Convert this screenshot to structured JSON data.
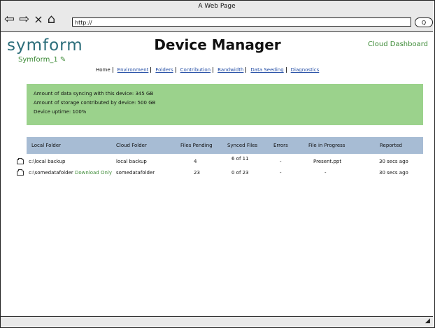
{
  "browser": {
    "title": "A Web Page",
    "url": "http://",
    "search_icon_text": "Q"
  },
  "header": {
    "logo": "symform",
    "title": "Device Manager",
    "cloud_link": "Cloud Dashboard",
    "machine_name": "Symform_1"
  },
  "tabs": [
    {
      "label": "Home"
    },
    {
      "label": "Environment"
    },
    {
      "label": "Folders"
    },
    {
      "label": "Contribution"
    },
    {
      "label": "Bandwidth"
    },
    {
      "label": "Data Seeding"
    },
    {
      "label": "Diagnostics"
    }
  ],
  "summary": {
    "line1": "Amount of data syncing with this device: 345 GB",
    "line2": "Amount of storage contributed by device: 500 GB",
    "line3": "Device uptime: 100%"
  },
  "table": {
    "headers": [
      "Local Folder",
      "Cloud Folder",
      "Files Pending",
      "Synced Files",
      "Errors",
      "File in Progress",
      "Reported"
    ],
    "rows": [
      [
        "c:\\local backup",
        "local backup",
        "4",
        "6 of 11",
        "-",
        "Present.ppt",
        "30 secs ago"
      ],
      [
        "c:\\somedatafolder",
        "somedatafolder",
        "23",
        "0 of 23",
        "-",
        "-",
        "30 secs ago"
      ]
    ],
    "row2_tag": "Download Only"
  }
}
